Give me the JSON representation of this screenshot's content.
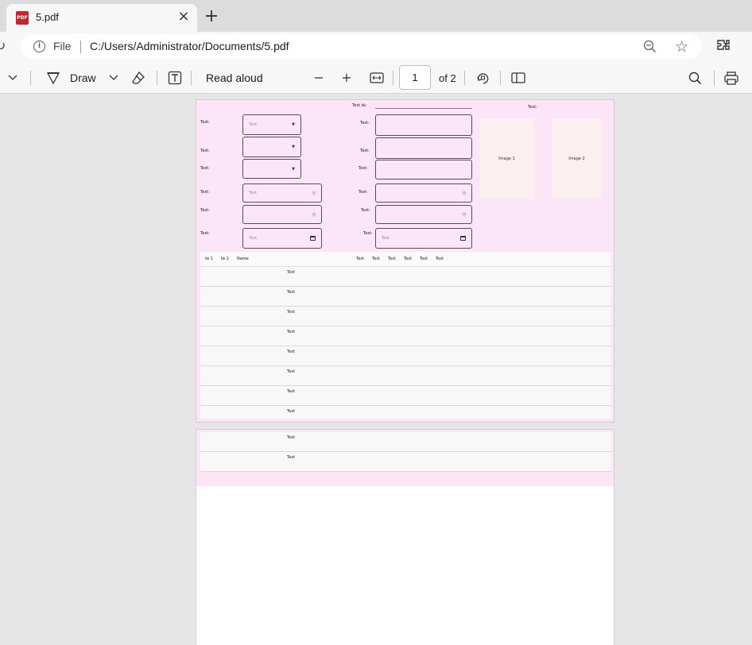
{
  "browser": {
    "tab": {
      "title": "5.pdf",
      "icon": "pdf-file-icon"
    },
    "address": {
      "scheme_label": "File",
      "url": "C:/Users/Administrator/Documents/5.pdf"
    }
  },
  "pdf_toolbar": {
    "draw_label": "Draw",
    "read_aloud_label": "Read aloud",
    "page_current": "1",
    "page_total": "of 2"
  },
  "document": {
    "page1": {
      "header_number_label": "Text №:",
      "header_right_label": "Text:",
      "left_fields": [
        {
          "label": "Text:",
          "placeholder": "Text",
          "kind": "select"
        },
        {
          "label": "Text:",
          "placeholder": "",
          "kind": "select"
        },
        {
          "label": "Text:",
          "placeholder": "",
          "kind": "select"
        },
        {
          "label": "Text:",
          "placeholder": "Text",
          "kind": "clearable"
        },
        {
          "label": "Text:",
          "placeholder": "",
          "kind": "clearable"
        },
        {
          "label": "Text:",
          "placeholder": "Text",
          "kind": "date"
        }
      ],
      "right_fields": [
        {
          "label": "Text:"
        },
        {
          "label": "Text:"
        },
        {
          "label": "Text:"
        },
        {
          "label": "Text:",
          "kind": "clearable"
        },
        {
          "label": "Text:",
          "kind": "clearable"
        },
        {
          "label": "Text:",
          "placeholder": "Text",
          "kind": "date"
        }
      ],
      "images": [
        "Image 1",
        "Image 2"
      ],
      "table": {
        "headers": [
          "№ 1",
          "№ 2",
          "Name",
          "Text",
          "Text",
          "Text",
          "Text",
          "Text",
          "Text"
        ],
        "rows": [
          "Text",
          "Text",
          "Text",
          "Text",
          "Text",
          "Text",
          "Text",
          "Text"
        ]
      }
    },
    "page2": {
      "rows": [
        "Text",
        "Text"
      ]
    }
  }
}
